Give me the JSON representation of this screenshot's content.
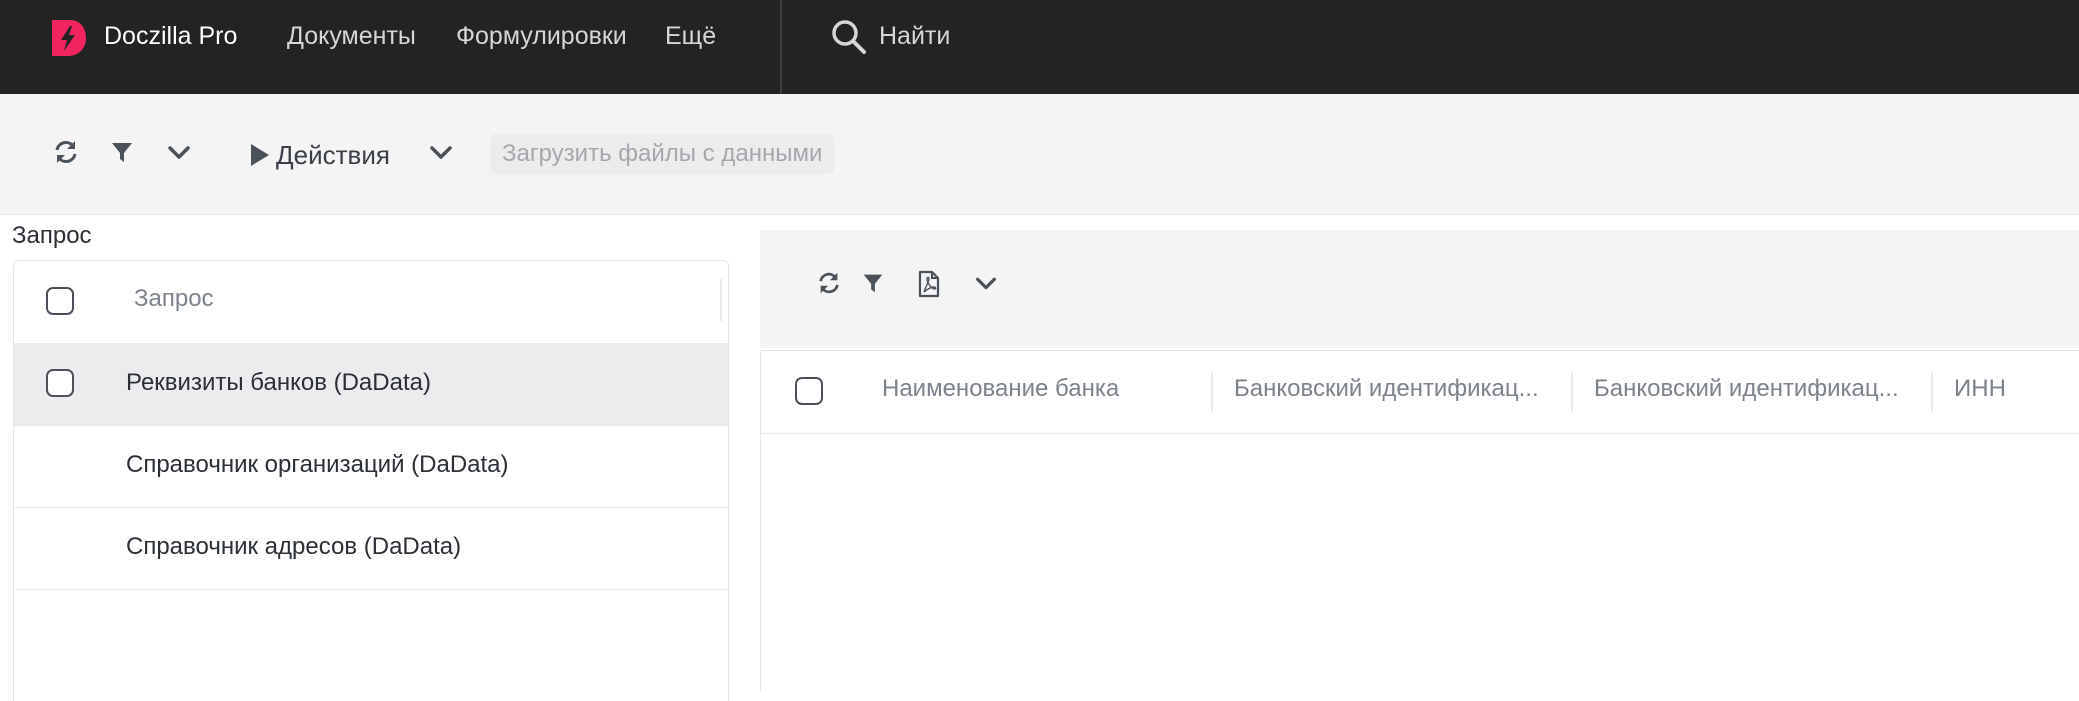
{
  "app": {
    "title": "Doczilla Pro",
    "brand_color": "#f0245e",
    "logo_icon": "doczilla-logo-icon"
  },
  "nav": {
    "items": [
      {
        "label": "Документы"
      },
      {
        "label": "Формулировки"
      },
      {
        "label": "Ещё"
      }
    ],
    "search_label": "Найти"
  },
  "toolbar": {
    "icons": [
      "refresh-icon",
      "filter-icon",
      "chevron-down-icon"
    ],
    "actions_label": "Действия",
    "upload_label": "Загрузить файлы с данными"
  },
  "left_panel": {
    "title": "Запрос",
    "column_header": "Запрос",
    "rows": [
      {
        "label": "Реквизиты банков (DaData)",
        "selected": true
      },
      {
        "label": "Справочник организаций (DaData)",
        "selected": false
      },
      {
        "label": "Справочник адресов (DaData)",
        "selected": false
      }
    ]
  },
  "right_panel": {
    "toolbar_icons": [
      "refresh-icon",
      "filter-icon",
      "pdf-icon",
      "chevron-down-icon"
    ],
    "columns": [
      {
        "label": "Наименование банка"
      },
      {
        "label": "Банковский идентификац..."
      },
      {
        "label": "Банковский идентификац..."
      },
      {
        "label": "ИНН"
      }
    ]
  }
}
